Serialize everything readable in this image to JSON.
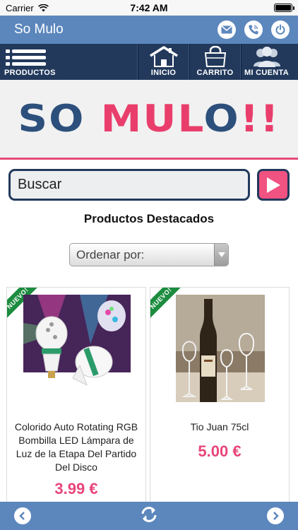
{
  "status_bar": {
    "carrier": "Carrier",
    "time": "7:42 AM"
  },
  "header": {
    "title": "So Mulo",
    "icons": [
      "mail-icon",
      "phone-icon",
      "power-icon"
    ]
  },
  "nav": {
    "products": "PRODUCTOS",
    "home": "INICIO",
    "cart": "CARRITO",
    "account": "MI CUENTA"
  },
  "logo": {
    "so": "SO",
    "mulo": "MUL",
    "o": "O",
    "bang": "!!"
  },
  "search": {
    "value": "Buscar"
  },
  "section_title": "Productos Destacados",
  "sort": {
    "selected": "Ordenar por:"
  },
  "products": [
    {
      "badge": "NUEVO!",
      "name": "Colorido Auto Rotating RGB Bombilla LED Lámpara de Luz de la Etapa Del Partido Del Disco",
      "price": "3.99 €"
    },
    {
      "badge": "NUEVO!",
      "name": "Tio Juan 75cl",
      "price": "5.00 €"
    }
  ],
  "colors": {
    "header_blue": "#5c87bd",
    "nav_dark": "#22395c",
    "accent_pink": "#e8457a",
    "badge_green": "#1c8c3f"
  }
}
